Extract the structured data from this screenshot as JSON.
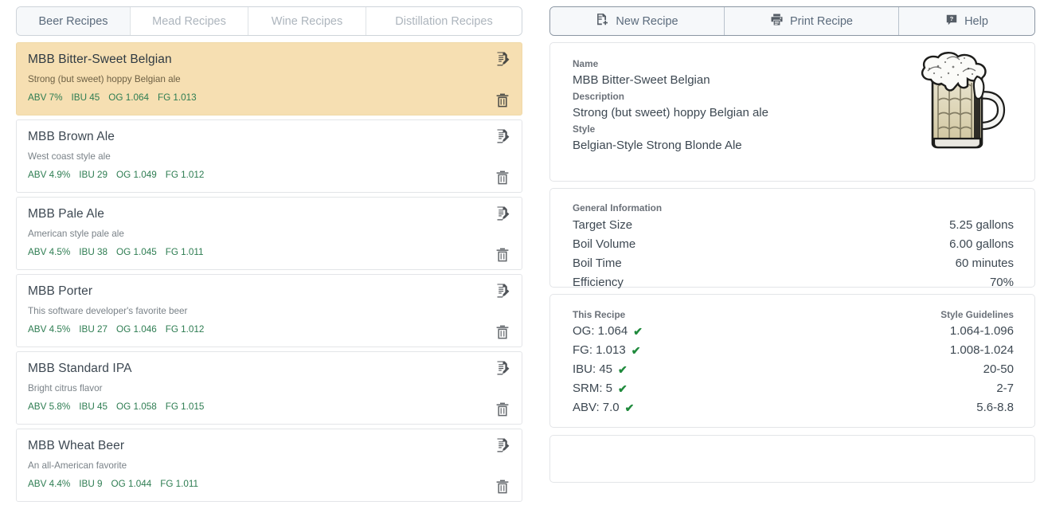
{
  "tabs": [
    {
      "label": "Beer Recipes",
      "active": true
    },
    {
      "label": "Mead Recipes",
      "active": false
    },
    {
      "label": "Wine Recipes",
      "active": false
    },
    {
      "label": "Distillation Recipes",
      "active": false
    }
  ],
  "toolbar": {
    "new_recipe": "New Recipe",
    "print_recipe": "Print Recipe",
    "help": "Help"
  },
  "recipes": [
    {
      "name": "MBB Bitter-Sweet Belgian",
      "description": "Strong (but sweet) hoppy Belgian ale",
      "abv": "ABV 7%",
      "ibu": "IBU 45",
      "og": "OG 1.064",
      "fg": "FG 1.013",
      "selected": true
    },
    {
      "name": "MBB Brown Ale",
      "description": "West coast style ale",
      "abv": "ABV 4.9%",
      "ibu": "IBU 29",
      "og": "OG 1.049",
      "fg": "FG 1.012",
      "selected": false
    },
    {
      "name": "MBB Pale Ale",
      "description": "American style pale ale",
      "abv": "ABV 4.5%",
      "ibu": "IBU 38",
      "og": "OG 1.045",
      "fg": "FG 1.011",
      "selected": false
    },
    {
      "name": "MBB Porter",
      "description": "This software developer's favorite beer",
      "abv": "ABV 4.5%",
      "ibu": "IBU 27",
      "og": "OG 1.046",
      "fg": "FG 1.012",
      "selected": false
    },
    {
      "name": "MBB Standard IPA",
      "description": "Bright citrus flavor",
      "abv": "ABV 5.8%",
      "ibu": "IBU 45",
      "og": "OG 1.058",
      "fg": "FG 1.015",
      "selected": false
    },
    {
      "name": "MBB Wheat Beer",
      "description": "An all-American favorite",
      "abv": "ABV 4.4%",
      "ibu": "IBU 9",
      "og": "OG 1.044",
      "fg": "FG 1.011",
      "selected": false
    }
  ],
  "detail": {
    "identity": {
      "name_label": "Name",
      "name_value": "MBB Bitter-Sweet Belgian",
      "description_label": "Description",
      "description_value": "Strong (but sweet) hoppy Belgian ale",
      "style_label": "Style",
      "style_value": "Belgian-Style Strong Blonde Ale"
    },
    "general": {
      "heading": "General Information",
      "rows": [
        {
          "label": "Target Size",
          "value": "5.25 gallons"
        },
        {
          "label": "Boil Volume",
          "value": "6.00 gallons"
        },
        {
          "label": "Boil Time",
          "value": "60 minutes"
        },
        {
          "label": "Efficiency",
          "value": "70%"
        }
      ]
    },
    "stats": {
      "left_heading": "This Recipe",
      "right_heading": "Style Guidelines",
      "rows": [
        {
          "value": "OG: 1.064",
          "check": "✔",
          "guideline": "1.064-1.096"
        },
        {
          "value": "FG: 1.013",
          "check": "✔",
          "guideline": "1.008-1.024"
        },
        {
          "value": "IBU: 45",
          "check": "✔",
          "guideline": "20-50"
        },
        {
          "value": "SRM: 5",
          "check": "✔",
          "guideline": "2-7"
        },
        {
          "value": "ABV: 7.0",
          "check": "✔",
          "guideline": "5.6-8.8"
        }
      ]
    }
  },
  "colors": {
    "selected_row_bg": "#f6dfb2",
    "stat_green": "#2e7d52",
    "check_green": "#1f8a3c",
    "text_primary": "#3d4852",
    "text_muted": "#7a8288",
    "tab_inactive": "#adb5bd",
    "border": "#e3e5e8"
  }
}
